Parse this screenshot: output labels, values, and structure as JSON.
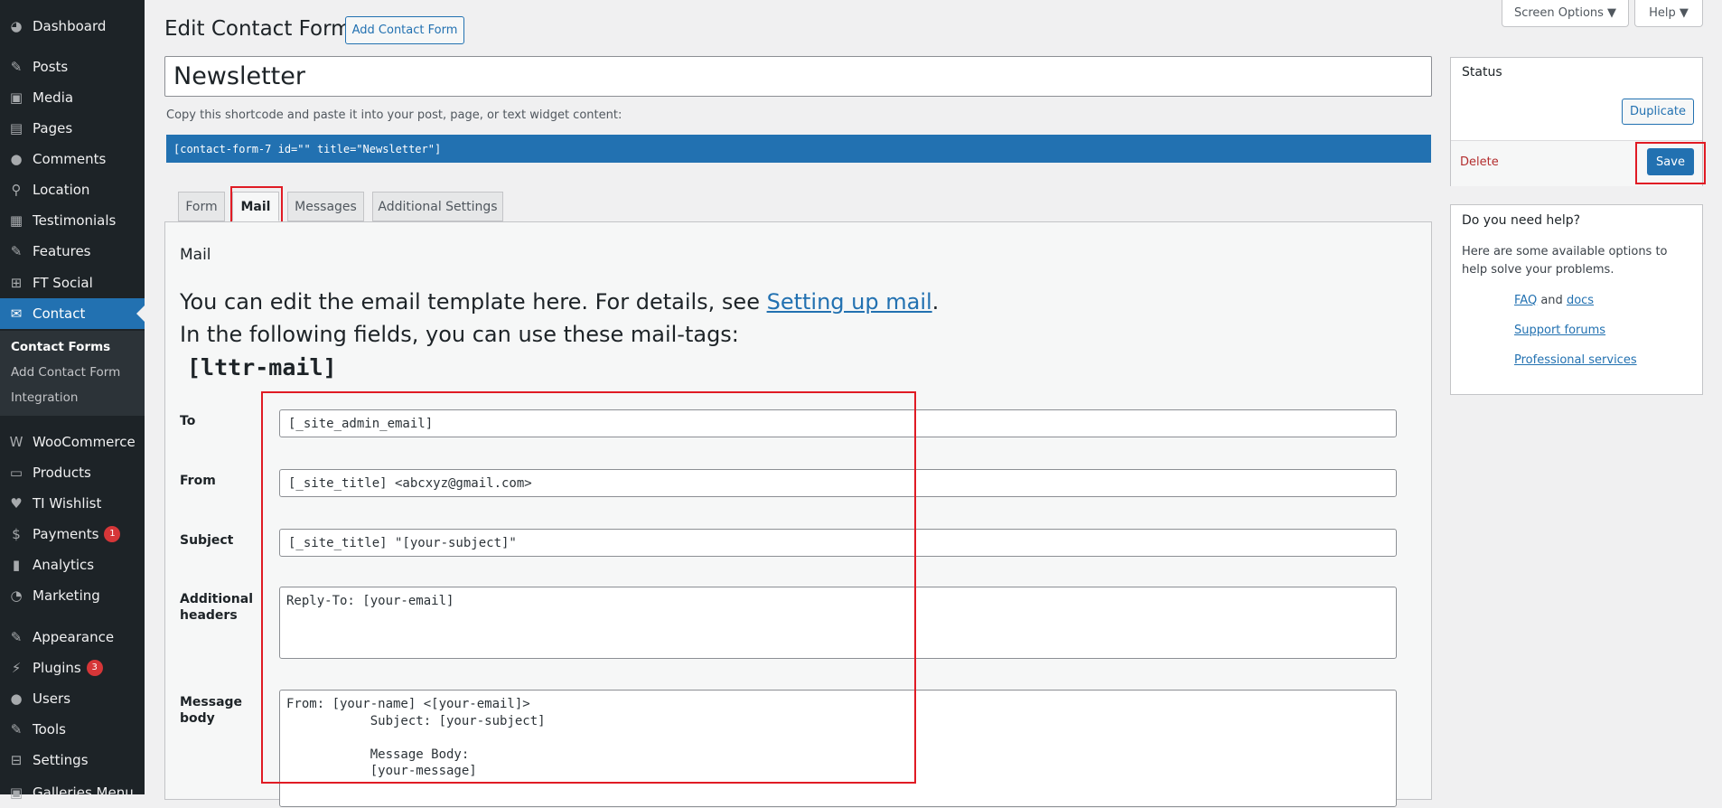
{
  "sidebar": {
    "items": [
      {
        "label": "Dashboard",
        "icon": "dashboard-icon",
        "glyph": "◕"
      },
      {
        "label": "Posts",
        "icon": "pin-icon",
        "glyph": "✎"
      },
      {
        "label": "Media",
        "icon": "media-icon",
        "glyph": "▣"
      },
      {
        "label": "Pages",
        "icon": "pages-icon",
        "glyph": "▤"
      },
      {
        "label": "Comments",
        "icon": "comment-icon",
        "glyph": "●"
      },
      {
        "label": "Location",
        "icon": "location-icon",
        "glyph": "⚲"
      },
      {
        "label": "Testimonials",
        "icon": "testimonials-icon",
        "glyph": "▦"
      },
      {
        "label": "Features",
        "icon": "wrench-icon",
        "glyph": "✎"
      },
      {
        "label": "FT Social",
        "icon": "grid-icon",
        "glyph": "⊞"
      },
      {
        "label": "Contact",
        "icon": "mail-icon",
        "glyph": "✉"
      },
      {
        "label": "WooCommerce",
        "icon": "woo-icon",
        "glyph": "W"
      },
      {
        "label": "Products",
        "icon": "products-icon",
        "glyph": "▭"
      },
      {
        "label": "TI Wishlist",
        "icon": "heart-icon",
        "glyph": "♥"
      },
      {
        "label": "Payments",
        "icon": "payments-icon",
        "glyph": "$",
        "badge": "1"
      },
      {
        "label": "Analytics",
        "icon": "analytics-icon",
        "glyph": "▮"
      },
      {
        "label": "Marketing",
        "icon": "megaphone-icon",
        "glyph": "◔"
      },
      {
        "label": "Appearance",
        "icon": "brush-icon",
        "glyph": "✎"
      },
      {
        "label": "Plugins",
        "icon": "plugin-icon",
        "glyph": "⚡",
        "badge": "3"
      },
      {
        "label": "Users",
        "icon": "user-icon",
        "glyph": "●"
      },
      {
        "label": "Tools",
        "icon": "tools-icon",
        "glyph": "✎"
      },
      {
        "label": "Settings",
        "icon": "settings-icon",
        "glyph": "⊟"
      },
      {
        "label": "Galleries Menu",
        "icon": "gallery-icon",
        "glyph": "▣"
      }
    ],
    "submenu": [
      "Contact Forms",
      "Add Contact Form",
      "Integration"
    ]
  },
  "top": {
    "screen_options": "Screen Options ▼",
    "help": "Help ▼"
  },
  "header": {
    "title": "Edit Contact Form",
    "add_button": "Add Contact Form"
  },
  "form_title": "Newsletter",
  "shortcode_hint": "Copy this shortcode and paste it into your post, page, or text widget content:",
  "shortcode": "[contact-form-7 id=\"\" title=\"Newsletter\"]",
  "tabs": [
    "Form",
    "Mail",
    "Messages",
    "Additional Settings"
  ],
  "panel": {
    "title": "Mail",
    "line1_prefix": "You can edit the email template here. For details, see ",
    "line1_link": "Setting up mail",
    "line1_suffix": ".",
    "line2": "In the following fields, you can use these mail-tags:",
    "mailtag": "[lttr-mail]"
  },
  "fields": {
    "to": {
      "label": "To",
      "value": "[_site_admin_email]"
    },
    "from": {
      "label": "From",
      "value": "[_site_title] <abcxyz@gmail.com>"
    },
    "subject": {
      "label": "Subject",
      "value": "[_site_title] \"[your-subject]\""
    },
    "headers": {
      "label1": "Additional",
      "label2": "headers",
      "value": "Reply-To: [your-email]"
    },
    "body": {
      "label1": "Message",
      "label2": "body",
      "value": "From: [your-name] <[your-email]>\n           Subject: [your-subject]\n\n           Message Body:\n           [your-message]"
    }
  },
  "status_box": {
    "title": "Status",
    "duplicate": "Duplicate",
    "delete": "Delete",
    "save": "Save"
  },
  "help_box": {
    "title": "Do you need help?",
    "text": "Here are some available options to help solve your problems.",
    "faq": "FAQ",
    "and": "and",
    "docs": "docs",
    "support": "Support forums",
    "professional": "Professional services"
  }
}
